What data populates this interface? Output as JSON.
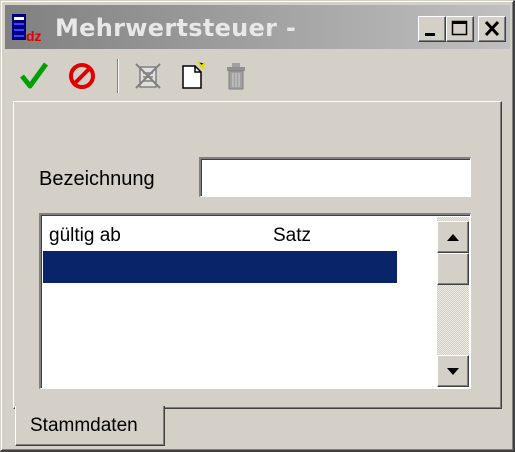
{
  "window": {
    "title": "Mehrwertsteuer -",
    "app_icon": "database-dz-icon",
    "minimize_icon": "minimize-icon",
    "maximize_icon": "maximize-icon",
    "close_icon": "close-icon"
  },
  "toolbar": {
    "items": [
      {
        "icon": "check-icon",
        "color": "#00a000"
      },
      {
        "icon": "cancel-icon",
        "color": "#e00000"
      },
      {
        "icon": "delete-record-icon",
        "color": "#808080"
      },
      {
        "icon": "new-record-icon",
        "color": "#ffff00"
      },
      {
        "icon": "trash-icon",
        "color": "#808080"
      }
    ]
  },
  "form": {
    "bezeichnung_label": "Bezeichnung",
    "bezeichnung_value": ""
  },
  "list": {
    "columns": [
      "gültig ab",
      "Satz"
    ],
    "selected_row_color": "#0a246a",
    "rows": [
      {
        "gueltig_ab": "",
        "satz": ""
      }
    ]
  },
  "tabs": {
    "active": "Stammdaten"
  }
}
